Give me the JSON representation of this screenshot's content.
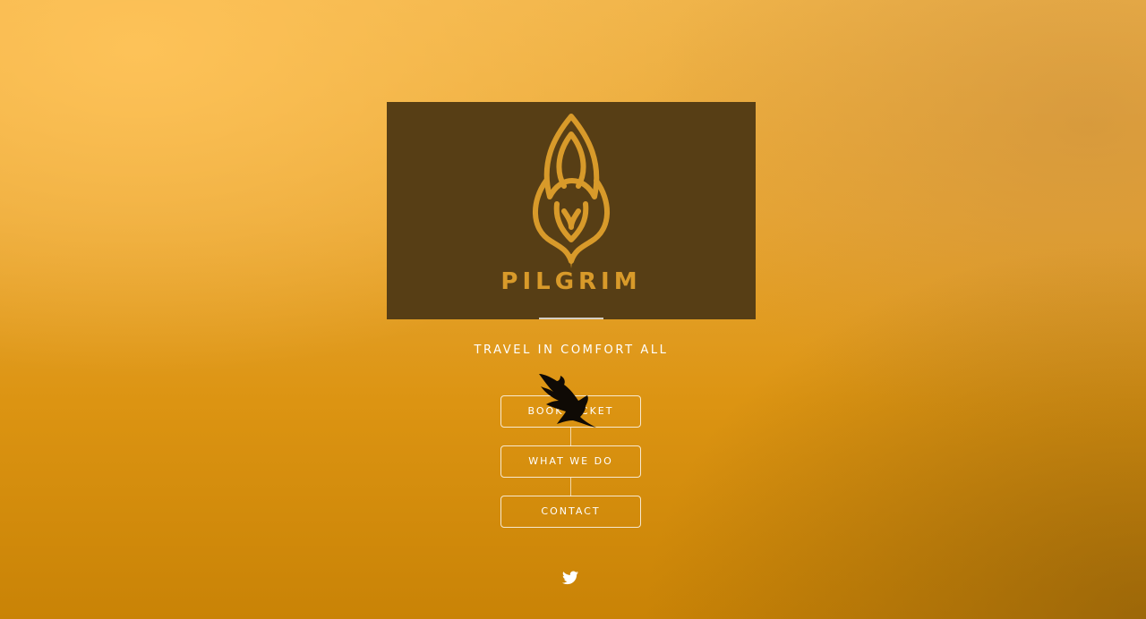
{
  "brand": {
    "name": "PILGRIM",
    "logo_color": "#d89a2a",
    "card_color": "#573e15"
  },
  "tagline": "TRAVEL IN COMFORT ALL",
  "nav": {
    "book_label": "BOOK TICKET",
    "what_label": "WHAT WE DO",
    "contact_label": "CONTACT"
  },
  "social": {
    "icon": "twitter-icon"
  }
}
